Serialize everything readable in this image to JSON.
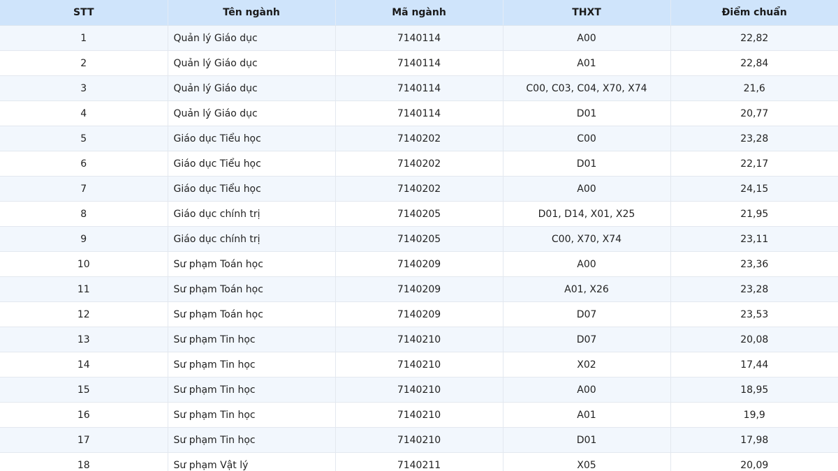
{
  "table": {
    "headers": [
      "STT",
      "Tên ngành",
      "Mã ngành",
      "THXT",
      "Điểm chuẩn"
    ],
    "rows": [
      [
        "1",
        "Quản lý Giáo dục",
        "7140114",
        "A00",
        "22,82"
      ],
      [
        "2",
        "Quản lý Giáo dục",
        "7140114",
        "A01",
        "22,84"
      ],
      [
        "3",
        "Quản lý Giáo dục",
        "7140114",
        "C00, C03, C04, X70, X74",
        "21,6"
      ],
      [
        "4",
        "Quản lý Giáo dục",
        "7140114",
        "D01",
        "20,77"
      ],
      [
        "5",
        "Giáo dục Tiểu học",
        "7140202",
        "C00",
        "23,28"
      ],
      [
        "6",
        "Giáo dục Tiểu học",
        "7140202",
        "D01",
        "22,17"
      ],
      [
        "7",
        "Giáo dục Tiểu học",
        "7140202",
        "A00",
        "24,15"
      ],
      [
        "8",
        "Giáo dục chính trị",
        "7140205",
        "D01, D14, X01, X25",
        "21,95"
      ],
      [
        "9",
        "Giáo dục chính trị",
        "7140205",
        "C00, X70, X74",
        "23,11"
      ],
      [
        "10",
        "Sư phạm Toán học",
        "7140209",
        "A00",
        "23,36"
      ],
      [
        "11",
        "Sư phạm Toán học",
        "7140209",
        "A01, X26",
        "23,28"
      ],
      [
        "12",
        "Sư phạm Toán học",
        "7140209",
        "D07",
        "23,53"
      ],
      [
        "13",
        "Sư phạm Tin học",
        "7140210",
        "D07",
        "20,08"
      ],
      [
        "14",
        "Sư phạm Tin học",
        "7140210",
        "X02",
        "17,44"
      ],
      [
        "15",
        "Sư phạm Tin học",
        "7140210",
        "A00",
        "18,95"
      ],
      [
        "16",
        "Sư phạm Tin học",
        "7140210",
        "A01",
        "19,9"
      ],
      [
        "17",
        "Sư phạm Tin học",
        "7140210",
        "D01",
        "17,98"
      ],
      [
        "18",
        "Sư phạm Vật lý",
        "7140211",
        "X05",
        "20,09"
      ]
    ]
  },
  "colors": {
    "header_bg": "#cfe4fb",
    "row_alt_bg": "#f2f7fd",
    "row_bg": "#ffffff"
  }
}
